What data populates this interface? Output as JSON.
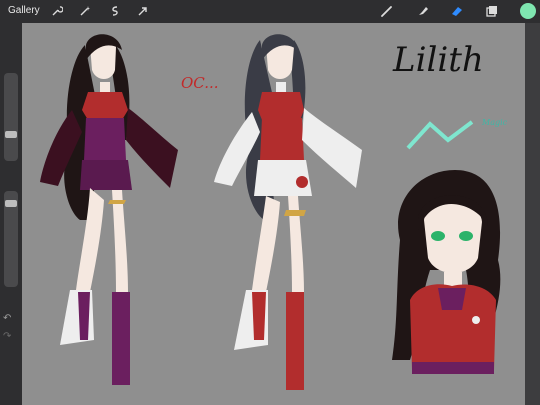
{
  "app": {
    "gallery_label": "Gallery"
  },
  "toolbar": {
    "left_tools": [
      "wrench-icon",
      "magic-wand-icon",
      "selection-icon",
      "transform-arrow-icon"
    ],
    "right_tools": [
      "brush-icon",
      "smudge-icon",
      "eraser-icon",
      "layers-icon"
    ],
    "active_tool": "eraser",
    "color_swatch": "#7fe6b0"
  },
  "canvas": {
    "title_text": "Lilith",
    "oc_text": "OC...",
    "magic_text": "Magic",
    "background": "#8f8f8f"
  },
  "colors": {
    "hair": "#1f1515",
    "red_top": "#b22d2d",
    "purple": "#6b1f5f",
    "white": "#eeeeee",
    "skin": "#f5e8e0",
    "gold": "#d1a545",
    "magic_line": "#7fe6cf",
    "eyes": "#2bb36a"
  }
}
